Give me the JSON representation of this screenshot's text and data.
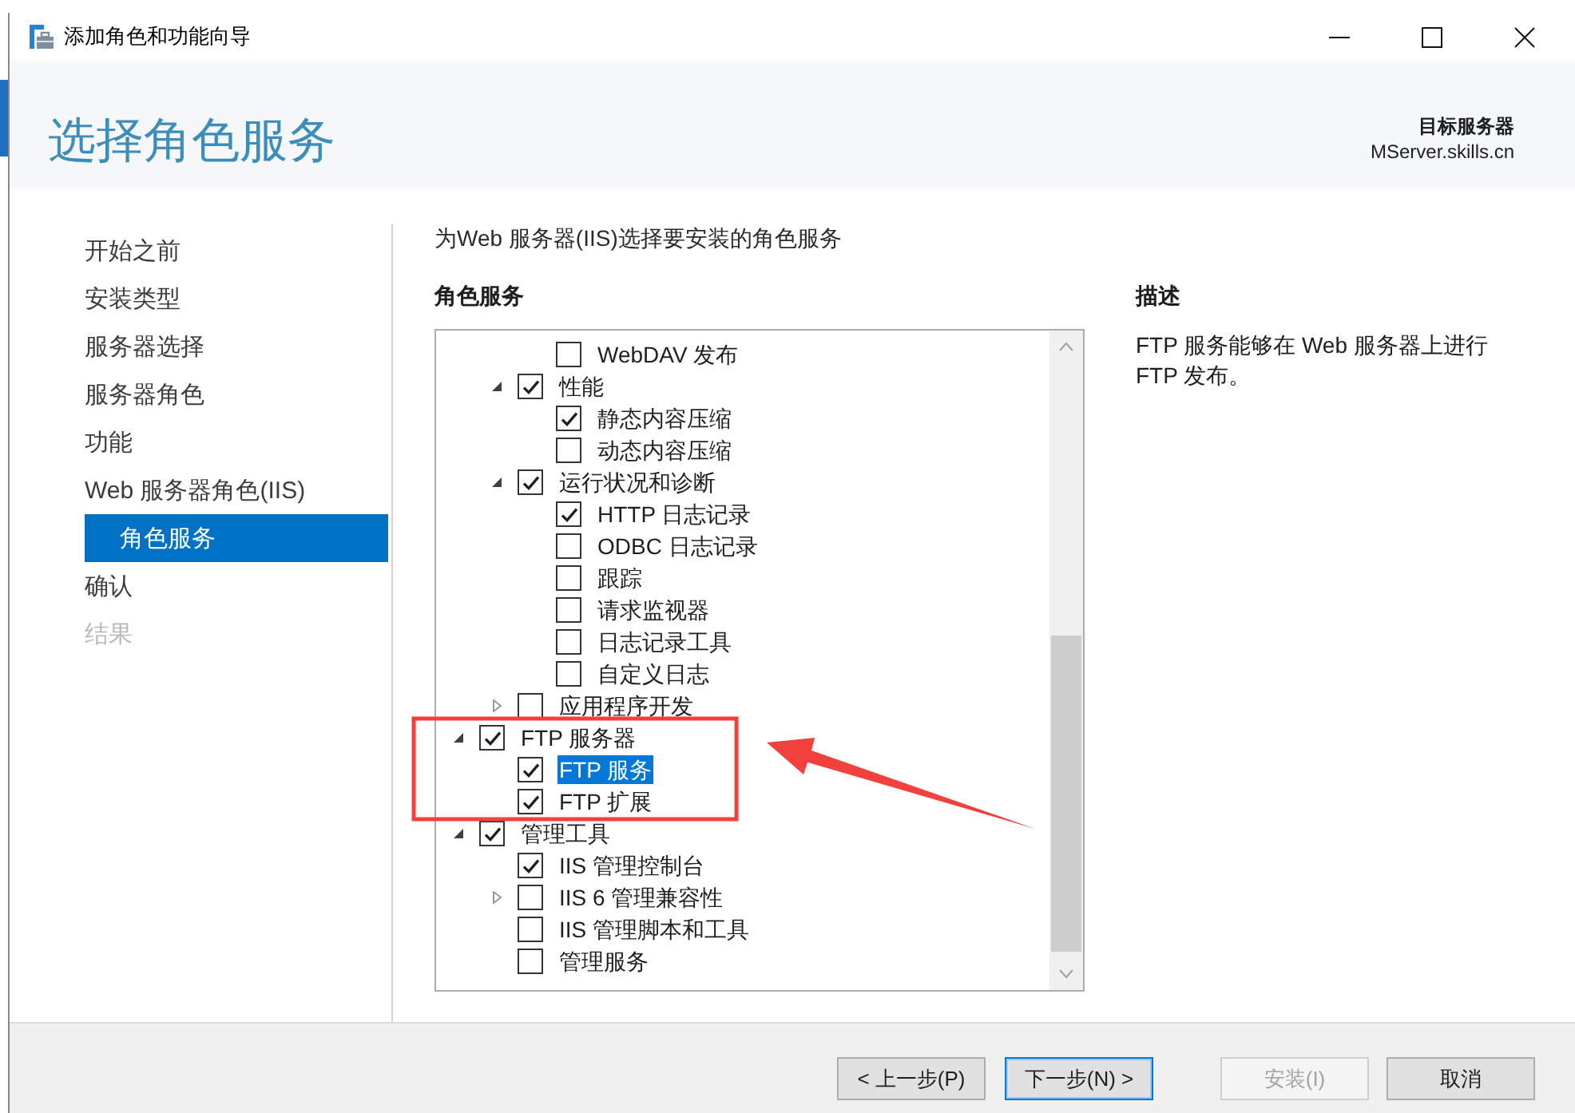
{
  "window": {
    "title": "添加角色和功能向导"
  },
  "header": {
    "heading": "选择角色服务",
    "target_label": "目标服务器",
    "target_server": "MServer.skills.cn"
  },
  "sidebar": {
    "items": [
      {
        "label": "开始之前",
        "selected": false,
        "disabled": false
      },
      {
        "label": "安装类型",
        "selected": false,
        "disabled": false
      },
      {
        "label": "服务器选择",
        "selected": false,
        "disabled": false
      },
      {
        "label": "服务器角色",
        "selected": false,
        "disabled": false
      },
      {
        "label": "功能",
        "selected": false,
        "disabled": false
      },
      {
        "label": "Web 服务器角色(IIS)",
        "selected": false,
        "disabled": false,
        "children": [
          {
            "label": "角色服务",
            "selected": true,
            "disabled": false
          }
        ]
      },
      {
        "label": "确认",
        "selected": false,
        "disabled": false
      },
      {
        "label": "结果",
        "selected": false,
        "disabled": true
      }
    ]
  },
  "content": {
    "instruction": "为Web 服务器(IIS)选择要安装的角色服务",
    "list_title": "角色服务",
    "tree": [
      {
        "children": [
          {
            "children": [
              {
                "label": "WebDAV 发布",
                "checked": false,
                "selected": false
              }
            ]
          },
          {
            "label": "性能",
            "checked": true,
            "expanded": true,
            "selected": false,
            "children": [
              {
                "label": "静态内容压缩",
                "checked": true,
                "selected": false
              },
              {
                "label": "动态内容压缩",
                "checked": false,
                "selected": false
              }
            ]
          },
          {
            "label": "运行状况和诊断",
            "checked": true,
            "expanded": true,
            "selected": false,
            "children": [
              {
                "label": "HTTP 日志记录",
                "checked": true,
                "selected": false
              },
              {
                "label": "ODBC 日志记录",
                "checked": false,
                "selected": false
              },
              {
                "label": "跟踪",
                "checked": false,
                "selected": false
              },
              {
                "label": "请求监视器",
                "checked": false,
                "selected": false
              },
              {
                "label": "日志记录工具",
                "checked": false,
                "selected": false
              },
              {
                "label": "自定义日志",
                "checked": false,
                "selected": false
              }
            ]
          },
          {
            "label": "应用程序开发",
            "checked": false,
            "expanded": false,
            "selected": false
          }
        ]
      },
      {
        "label": "FTP 服务器",
        "checked": true,
        "expanded": true,
        "selected": false,
        "children": [
          {
            "label": "FTP 服务",
            "checked": true,
            "selected": true
          },
          {
            "label": "FTP 扩展",
            "checked": true,
            "selected": false
          }
        ]
      },
      {
        "label": "管理工具",
        "checked": true,
        "expanded": true,
        "selected": false,
        "children": [
          {
            "label": "IIS 管理控制台",
            "checked": true,
            "selected": false
          },
          {
            "label": "IIS 6 管理兼容性",
            "checked": false,
            "expanded": false,
            "selected": false
          },
          {
            "label": "IIS 管理脚本和工具",
            "checked": false,
            "selected": false
          },
          {
            "label": "管理服务",
            "checked": false,
            "selected": false
          }
        ]
      }
    ]
  },
  "description": {
    "title": "描述",
    "text": "FTP 服务能够在 Web 服务器上进行 FTP 发布。"
  },
  "footer": {
    "navigation": [
      {
        "label": "< 上一步(P)",
        "disabled": false,
        "default": false
      },
      {
        "label": "下一步(N) >",
        "disabled": false,
        "default": true
      }
    ],
    "actions": [
      {
        "label": "安装(I)",
        "disabled": true,
        "default": false
      },
      {
        "label": "取消",
        "disabled": false,
        "default": false
      }
    ]
  }
}
